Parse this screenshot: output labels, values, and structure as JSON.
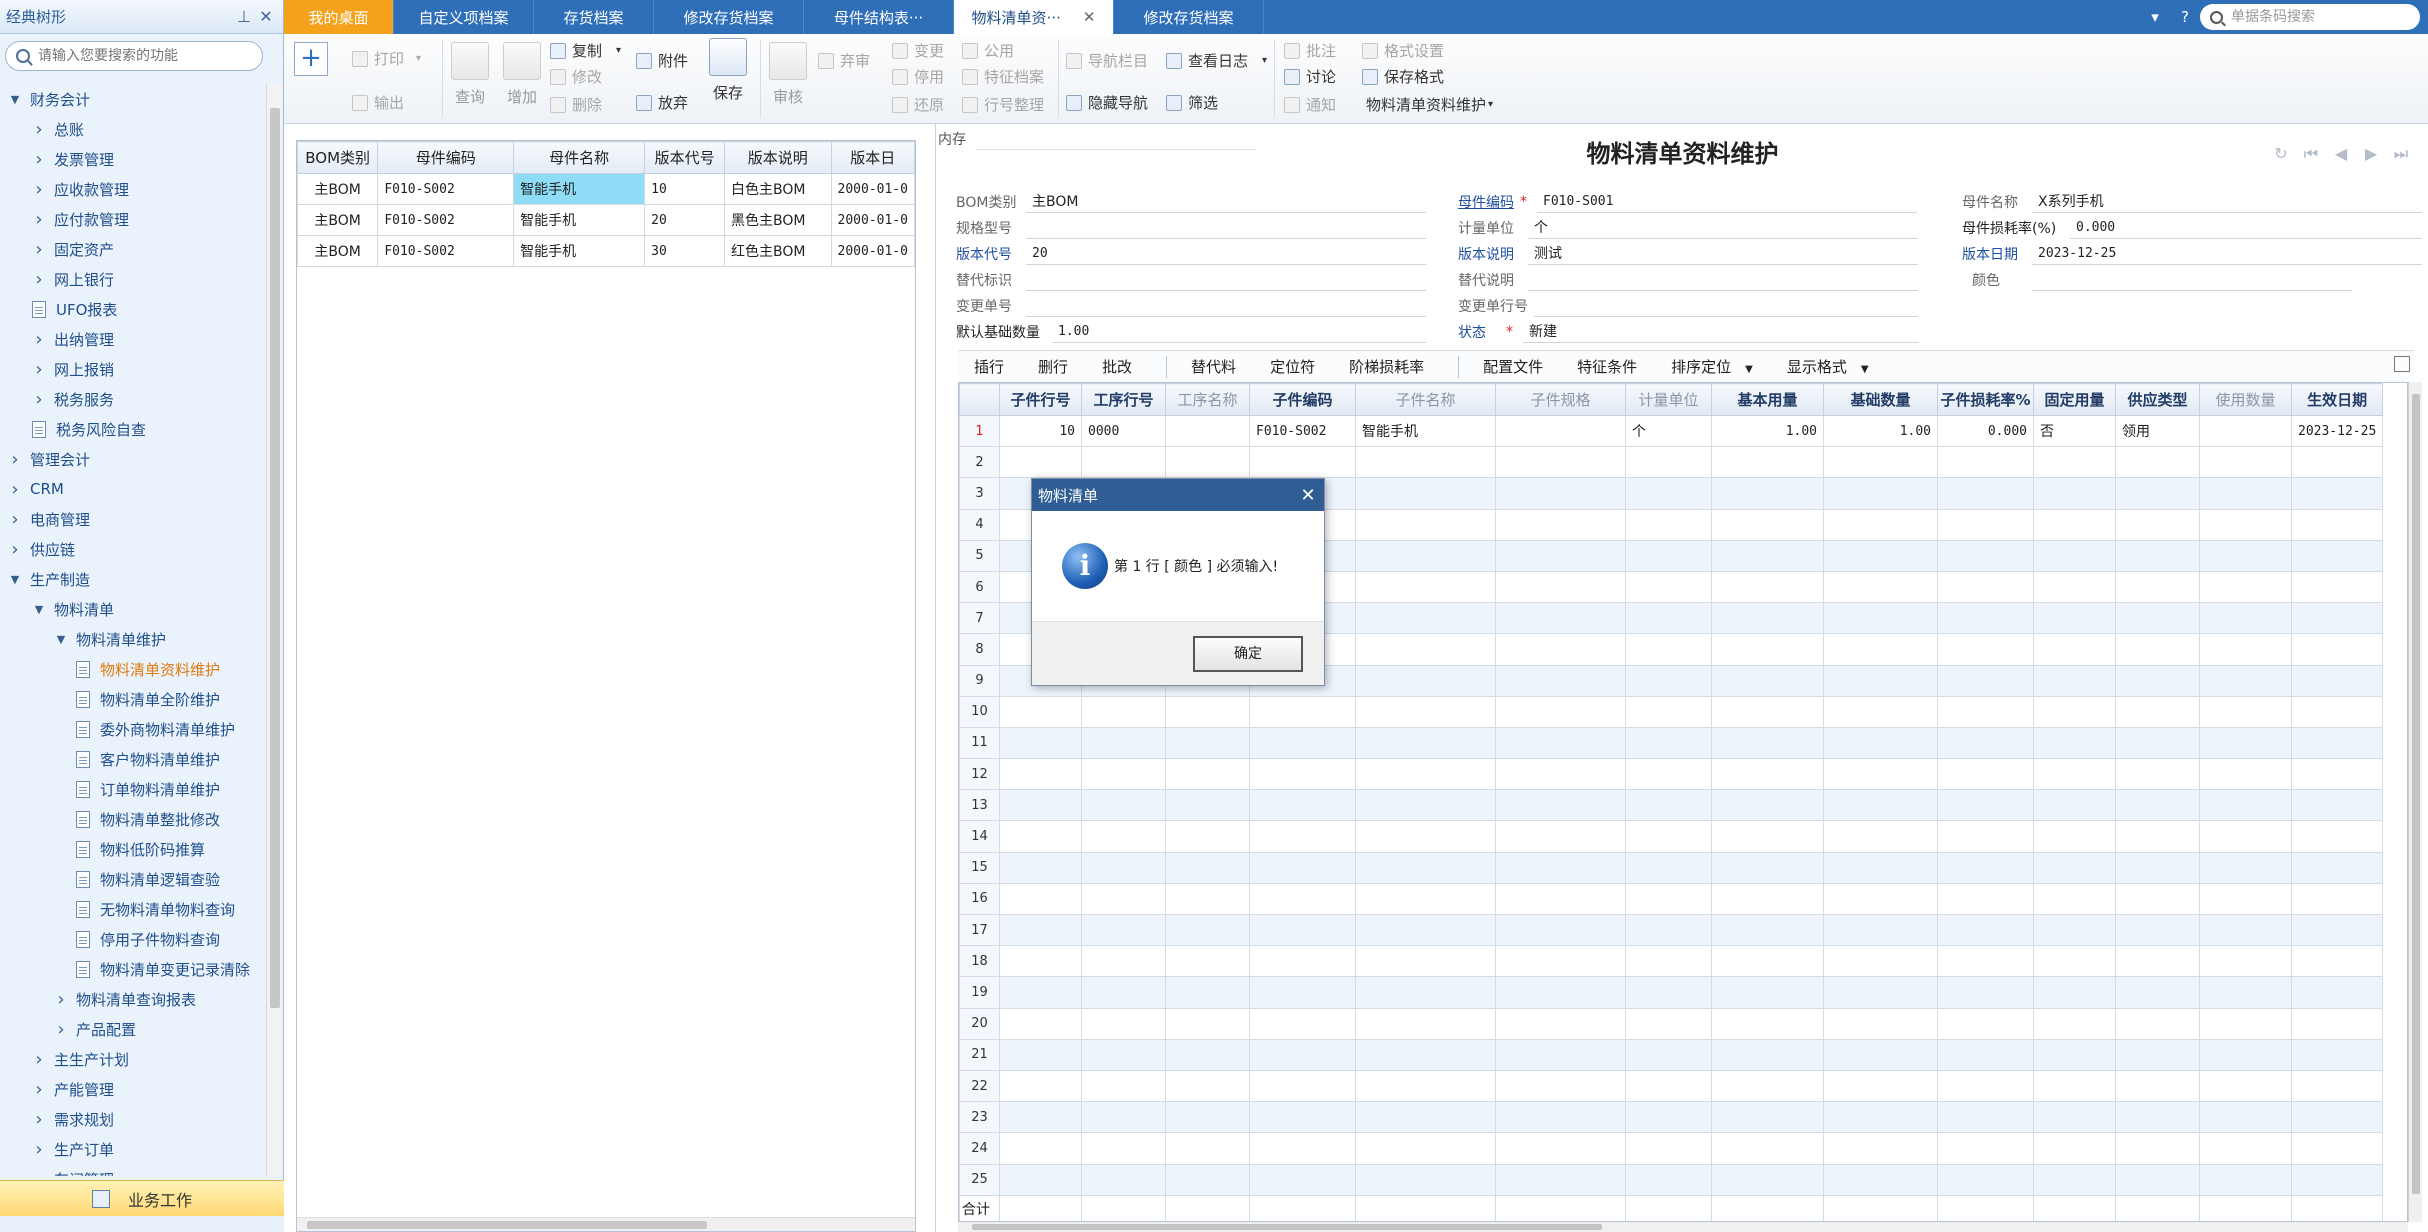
{
  "sidebar": {
    "title": "经典树形",
    "search_placeholder": "请输入您要搜索的功能",
    "footer_label": "业务工作",
    "items": [
      {
        "label": "财务会计",
        "level": 0,
        "type": "expanded"
      },
      {
        "label": "总账",
        "level": 1,
        "type": "collapsed"
      },
      {
        "label": "发票管理",
        "level": 1,
        "type": "collapsed"
      },
      {
        "label": "应收款管理",
        "level": 1,
        "type": "collapsed"
      },
      {
        "label": "应付款管理",
        "level": 1,
        "type": "collapsed"
      },
      {
        "label": "固定资产",
        "level": 1,
        "type": "collapsed"
      },
      {
        "label": "网上银行",
        "level": 1,
        "type": "collapsed"
      },
      {
        "label": "UFO报表",
        "level": 1,
        "type": "doc"
      },
      {
        "label": "出纳管理",
        "level": 1,
        "type": "collapsed"
      },
      {
        "label": "网上报销",
        "level": 1,
        "type": "collapsed"
      },
      {
        "label": "税务服务",
        "level": 1,
        "type": "collapsed"
      },
      {
        "label": "税务风险自查",
        "level": 1,
        "type": "doc"
      },
      {
        "label": "管理会计",
        "level": 0,
        "type": "collapsed"
      },
      {
        "label": "CRM",
        "level": 0,
        "type": "collapsed"
      },
      {
        "label": "电商管理",
        "level": 0,
        "type": "collapsed"
      },
      {
        "label": "供应链",
        "level": 0,
        "type": "collapsed"
      },
      {
        "label": "生产制造",
        "level": 0,
        "type": "expanded"
      },
      {
        "label": "物料清单",
        "level": 1,
        "type": "expanded"
      },
      {
        "label": "物料清单维护",
        "level": 2,
        "type": "expanded"
      },
      {
        "label": "物料清单资料维护",
        "level": 3,
        "type": "doc",
        "active": true
      },
      {
        "label": "物料清单全阶维护",
        "level": 3,
        "type": "doc"
      },
      {
        "label": "委外商物料清单维护",
        "level": 3,
        "type": "doc"
      },
      {
        "label": "客户物料清单维护",
        "level": 3,
        "type": "doc"
      },
      {
        "label": "订单物料清单维护",
        "level": 3,
        "type": "doc"
      },
      {
        "label": "物料清单整批修改",
        "level": 3,
        "type": "doc"
      },
      {
        "label": "物料低阶码推算",
        "level": 3,
        "type": "doc"
      },
      {
        "label": "物料清单逻辑查验",
        "level": 3,
        "type": "doc"
      },
      {
        "label": "无物料清单物料查询",
        "level": 3,
        "type": "doc"
      },
      {
        "label": "停用子件物料查询",
        "level": 3,
        "type": "doc"
      },
      {
        "label": "物料清单变更记录清除",
        "level": 3,
        "type": "doc"
      },
      {
        "label": "物料清单查询报表",
        "level": 2,
        "type": "collapsed"
      },
      {
        "label": "产品配置",
        "level": 2,
        "type": "collapsed"
      },
      {
        "label": "主生产计划",
        "level": 1,
        "type": "collapsed"
      },
      {
        "label": "产能管理",
        "level": 1,
        "type": "collapsed"
      },
      {
        "label": "需求规划",
        "level": 1,
        "type": "collapsed"
      },
      {
        "label": "生产订单",
        "level": 1,
        "type": "collapsed"
      },
      {
        "label": "车间管理",
        "level": 1,
        "type": "collapsed"
      }
    ]
  },
  "tabs": [
    {
      "label": "我的桌面",
      "kind": "home"
    },
    {
      "label": "自定义项档案",
      "kind": "normal"
    },
    {
      "label": "存货档案",
      "kind": "normal"
    },
    {
      "label": "修改存货档案",
      "kind": "normal"
    },
    {
      "label": "母件结构表···",
      "kind": "normal"
    },
    {
      "label": "物料清单资···",
      "kind": "active"
    },
    {
      "label": "修改存货档案",
      "kind": "normal"
    }
  ],
  "global_search_placeholder": "单据条码搜索",
  "ribbon": {
    "print": "打印",
    "export": "输出",
    "query": "查询",
    "add": "增加",
    "copy": "复制",
    "modify": "修改",
    "delete": "删除",
    "attach": "附件",
    "discard": "放弃",
    "save": "保存",
    "audit": "审核",
    "abandon": "弃审",
    "change": "变更",
    "disable": "停用",
    "restore": "还原",
    "common": "公用",
    "feature_archive": "特征档案",
    "row_sort": "行号整理",
    "nav_bar": "导航栏目",
    "view_log": "查看日志",
    "hide_nav": "隐藏导航",
    "filter": "筛选",
    "annotate": "批注",
    "discuss": "讨论",
    "notify": "通知",
    "format_settings": "格式设置",
    "save_format": "保存格式",
    "format_name": "物料清单资料维护"
  },
  "list": {
    "columns": [
      "BOM类别",
      "母件编码",
      "母件名称",
      "版本代号",
      "版本说明",
      "版本日"
    ],
    "rows": [
      [
        "主BOM",
        "F010-S002",
        "智能手机",
        "10",
        "白色主BOM",
        "2000-01-0"
      ],
      [
        "主BOM",
        "F010-S002",
        "智能手机",
        "20",
        "黑色主BOM",
        "2000-01-0"
      ],
      [
        "主BOM",
        "F010-S002",
        "智能手机",
        "30",
        "红色主BOM",
        "2000-01-0"
      ]
    ]
  },
  "form": {
    "cache_label": "内存",
    "title": "物料清单资料维护",
    "fields": {
      "bom_type_label": "BOM类别",
      "bom_type": "主BOM",
      "parent_code_label": "母件编码",
      "parent_code": "F010-S001",
      "parent_name_label": "母件名称",
      "parent_name": "X系列手机",
      "spec_label": "规格型号",
      "spec": "",
      "unit_label": "计量单位",
      "unit": "个",
      "loss_rate_label": "母件损耗率(%)",
      "loss_rate": "0.000",
      "version_code_label": "版本代号",
      "version_code": "20",
      "version_desc_label": "版本说明",
      "version_desc": "测试",
      "version_date_label": "版本日期",
      "version_date": "2023-12-25",
      "replace_tag_label": "替代标识",
      "replace_tag": "",
      "replace_desc_label": "替代说明",
      "replace_desc": "",
      "color_label": "颜色",
      "color": "",
      "change_no_label": "变更单号",
      "change_no": "",
      "change_row_label": "变更单行号",
      "change_row": "",
      "base_qty_label": "默认基础数量",
      "base_qty": "1.00",
      "status_label": "状态",
      "status": "新建"
    },
    "grid_tools": [
      "插行",
      "删行",
      "批改",
      "替代料",
      "定位符",
      "阶梯损耗率",
      "配置文件",
      "特征条件",
      "排序定位",
      "显示格式"
    ],
    "grid": {
      "columns": [
        "子件行号",
        "工序行号",
        "工序名称",
        "子件编码",
        "子件名称",
        "子件规格",
        "计量单位",
        "基本用量",
        "基础数量",
        "子件损耗率%",
        "固定用量",
        "供应类型",
        "使用数量",
        "生效日期"
      ],
      "gray_columns": [
        2,
        4,
        5,
        6,
        12
      ],
      "row1": [
        "10",
        "0000",
        "",
        "F010-S002",
        "智能手机",
        "",
        "个",
        "1.00",
        "1.00",
        "0.000",
        "否",
        "领用",
        "",
        "2023-12-25"
      ],
      "row_count": 25,
      "total_label": "合计"
    }
  },
  "dialog": {
    "title": "物料清单",
    "message": "第 1 行 [ 颜色 ] 必须输入!",
    "ok_label": "确定"
  }
}
